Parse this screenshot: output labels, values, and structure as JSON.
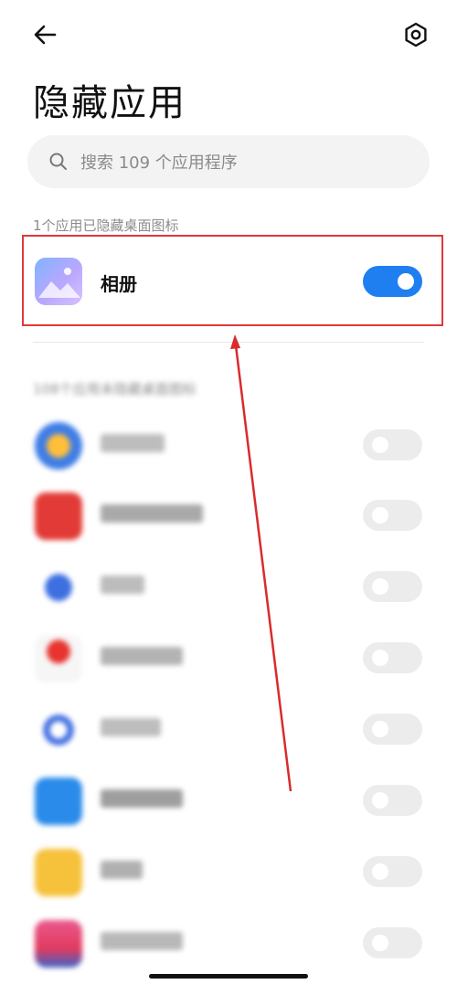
{
  "header": {
    "title": "隐藏应用",
    "back_icon": "arrow-left-icon",
    "settings_icon": "gear-icon"
  },
  "search": {
    "placeholder": "搜索 109 个应用程序"
  },
  "hidden_section": {
    "label": "1个应用已隐藏桌面图标",
    "apps": [
      {
        "name": "相册",
        "icon": "gallery-icon",
        "enabled": true
      }
    ]
  },
  "visible_section": {
    "label": "108个应用未隐藏桌面图标",
    "apps": [
      {
        "icon": "blurred-app-icon",
        "enabled": false
      },
      {
        "icon": "blurred-app-icon",
        "enabled": false
      },
      {
        "icon": "blurred-app-icon",
        "enabled": false
      },
      {
        "icon": "blurred-app-icon",
        "enabled": false
      },
      {
        "icon": "blurred-app-icon",
        "enabled": false
      },
      {
        "icon": "blurred-app-icon",
        "enabled": false
      },
      {
        "icon": "blurred-app-icon",
        "enabled": false
      },
      {
        "icon": "blurred-app-icon",
        "enabled": false
      }
    ]
  },
  "colors": {
    "accent": "#1f7ff0",
    "highlight": "#e1393a"
  }
}
